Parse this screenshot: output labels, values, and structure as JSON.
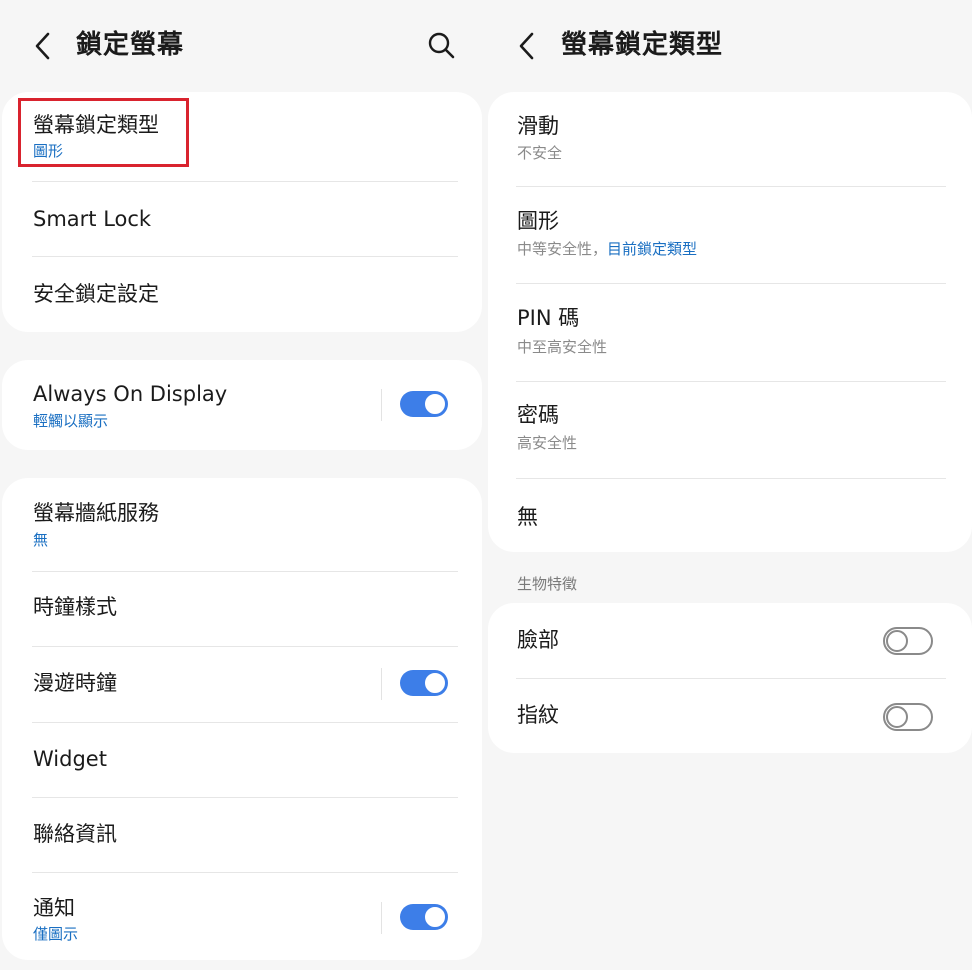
{
  "left": {
    "title": "鎖定螢幕",
    "card1": {
      "lock_type": {
        "label": "螢幕鎖定類型",
        "sub": "圖形"
      },
      "smart_lock": {
        "label": "Smart Lock"
      },
      "secure_lock": {
        "label": "安全鎖定設定"
      }
    },
    "card2": {
      "aod": {
        "label": "Always On Display",
        "sub": "輕觸以顯示",
        "toggle": "on"
      }
    },
    "card3": {
      "wallpaper": {
        "label": "螢幕牆紙服務",
        "sub": "無"
      },
      "clock_style": {
        "label": "時鐘樣式"
      },
      "roaming_clock": {
        "label": "漫遊時鐘",
        "toggle": "on"
      },
      "widget": {
        "label": "Widget"
      },
      "contact_info": {
        "label": "聯絡資訊"
      },
      "notifications": {
        "label": "通知",
        "sub": "僅圖示",
        "toggle": "on"
      }
    }
  },
  "right": {
    "title": "螢幕鎖定類型",
    "options": [
      {
        "label": "滑動",
        "sub": "不安全"
      },
      {
        "label": "圖形",
        "sub": "中等安全性，",
        "sub_highlight": "目前鎖定類型"
      },
      {
        "label": "PIN 碼",
        "sub": "中至高安全性"
      },
      {
        "label": "密碼",
        "sub": "高安全性"
      },
      {
        "label": "無"
      }
    ],
    "biometrics_section": "生物特徵",
    "biometrics": [
      {
        "label": "臉部",
        "toggle": "off"
      },
      {
        "label": "指紋",
        "toggle": "off"
      }
    ]
  },
  "colors": {
    "accent": "#3d7ee8",
    "link": "#1a6fc2",
    "highlight_box": "#d9232e"
  },
  "icons": {
    "back": "chevron-left-icon",
    "search": "search-icon"
  }
}
